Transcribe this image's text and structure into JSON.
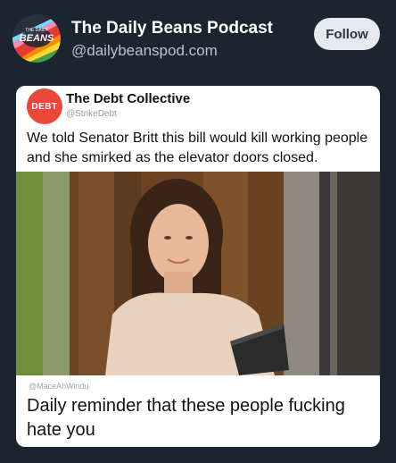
{
  "post": {
    "author_name": "The Daily Beans Podcast",
    "author_handle": "@dailybeanspod.com",
    "follow_label": "Follow",
    "avatar_text_top": "THE DAILY",
    "avatar_text_main": "BEANS"
  },
  "embed": {
    "avatar_text": "DEBT",
    "name": "The Debt Collective",
    "handle": "@StrikeDebt",
    "text": "We told Senator Britt this bill would kill working people and she smirked as the elevator doors closed.",
    "photo_credit": "@MaceAhWindu",
    "caption": "Daily reminder that these people fucking hate you"
  },
  "colors": {
    "background": "#1b2530",
    "follow_button": "#e6e9ed",
    "debt_red": "#e8483a"
  }
}
